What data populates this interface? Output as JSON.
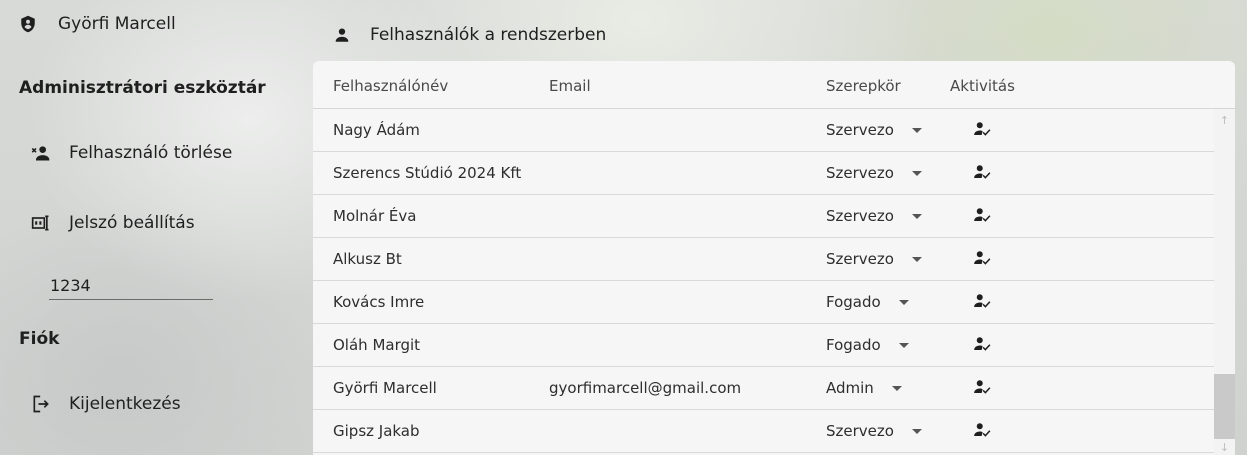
{
  "sidebar": {
    "user_name": "Györfi Marcell",
    "admin_title": "Adminisztrátori eszköztár",
    "delete_user_label": "Felhasználó törlése",
    "set_password_label": "Jelszó beállítás",
    "password_value": "1234",
    "account_title": "Fiók",
    "logout_label": "Kijelentkezés"
  },
  "main": {
    "title": "Felhasználók a rendszerben",
    "columns": [
      "Felhasználónév",
      "Email",
      "Szerepkör",
      "Aktivitás"
    ],
    "rows": [
      {
        "name": "Nagy Ádám",
        "email": "",
        "role": "Szervezo"
      },
      {
        "name": "Szerencs Stúdió 2024 Kft",
        "email": "",
        "role": "Szervezo"
      },
      {
        "name": "Molnár Éva",
        "email": "",
        "role": "Szervezo"
      },
      {
        "name": "Alkusz Bt",
        "email": "",
        "role": "Szervezo"
      },
      {
        "name": "Kovács Imre",
        "email": "",
        "role": "Fogado"
      },
      {
        "name": "Oláh Margit",
        "email": "",
        "role": "Fogado"
      },
      {
        "name": "Györfi Marcell",
        "email": "gyorfimarcell@gmail.com",
        "role": "Admin"
      },
      {
        "name": "Gipsz Jakab",
        "email": "",
        "role": "Szervezo"
      }
    ]
  },
  "icons": {
    "user": "shield-user-icon",
    "delete_user": "person-remove-icon",
    "password": "password-icon",
    "logout": "logout-icon",
    "header": "person-icon",
    "activity": "person-check-icon"
  }
}
